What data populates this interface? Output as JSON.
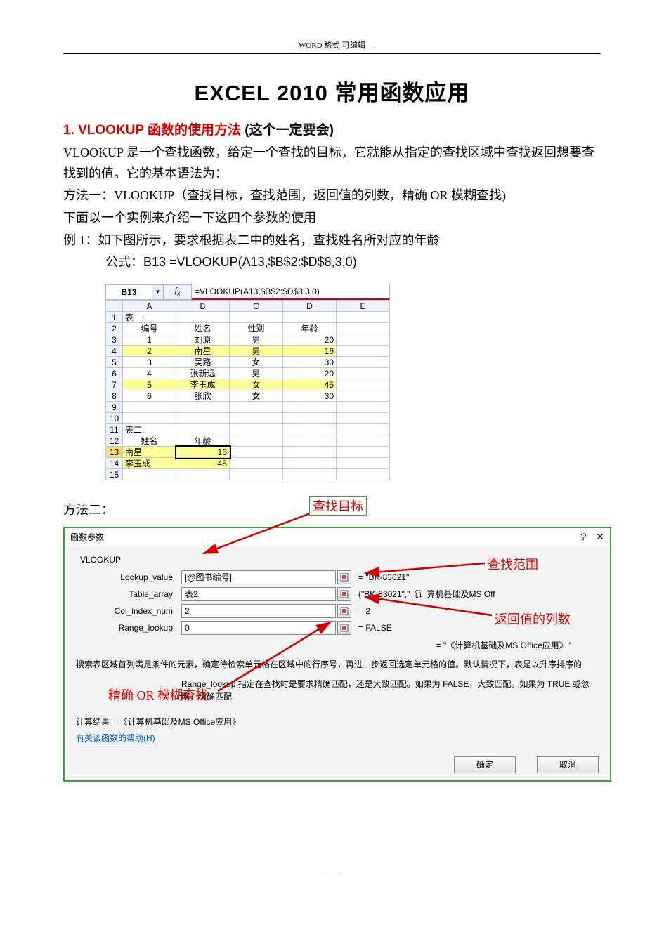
{
  "header_note": "—WORD 格式-可编辑—",
  "title": "EXCEL 2010   常用函数应用",
  "section1": {
    "num": "1. ",
    "name": "VLOOKUP   函数的使用方法 ",
    "note": "(这个一定要会)"
  },
  "para1": "VLOOKUP  是一个查找函数，给定一个查找的目标，它就能从指定的查找区域中查找返回想要查找到的值。它的基本语法为：",
  "para2": "方法一：VLOOKUP（查找目标，查找范围，返回值的列数，精确 OR  模糊查找)",
  "para3": "下面以一个实例来介绍一下这四个参数的使用",
  "para4": "例 1：如下图所示，要求根据表二中的姓名，查找姓名所对应的年龄",
  "para5": "公式：B13  =VLOOKUP(A13,$B$2:$D$8,3,0)",
  "excel": {
    "namebox": "B13",
    "formula": "=VLOOKUP(A13,$B$2:$D$8,3,0)",
    "cols": [
      "A",
      "B",
      "C",
      "D",
      "E"
    ],
    "row1": "表一:",
    "hdr": [
      "编号",
      "姓名",
      "性别",
      "年龄"
    ],
    "rows": [
      [
        "1",
        "刘原",
        "男",
        "20"
      ],
      [
        "2",
        "南星",
        "男",
        "16"
      ],
      [
        "3",
        "吴路",
        "女",
        "30"
      ],
      [
        "4",
        "张新远",
        "男",
        "20"
      ],
      [
        "5",
        "李玉成",
        "女",
        "45"
      ],
      [
        "6",
        "张欣",
        "女",
        "30"
      ]
    ],
    "row11": "表二:",
    "hdr2": [
      "姓名",
      "年龄"
    ],
    "row13": [
      "南星",
      "16"
    ],
    "row14": [
      "李玉成",
      "45"
    ]
  },
  "method2_label": "方法二：",
  "annotations": {
    "lookup_target": "查找目标",
    "lookup_range": "查找范围",
    "col_index": "返回值的列数",
    "match_type": "精确 OR  模糊查找"
  },
  "dialog": {
    "title": "函数参数",
    "fn": "VLOOKUP",
    "params": [
      {
        "label": "Lookup_value",
        "value": "[@图书编号]",
        "result": "= \"BK-83021\""
      },
      {
        "label": "Table_array",
        "value": "表2",
        "result": "{\"BK-83021\",\"《计算机基础及MS Off"
      },
      {
        "label": "Col_index_num",
        "value": "2",
        "result": "= 2"
      },
      {
        "label": "Range_lookup",
        "value": "0",
        "result": "= FALSE"
      }
    ],
    "eval_line": "= \"《计算机基础及MS Office应用》\"",
    "desc": "搜索表区域首列满足条件的元素，确定待检索单元格在区域中的行序号，再进一步返回选定单元格的值。默认情况下，表是以升序排序的",
    "range_desc": "Range_lookup   指定在查找时是要求精确匹配，还是大致匹配。如果为 FALSE，大致匹配。如果为 TRUE 或忽略，精确匹配",
    "result_label": "计算结果 =   《计算机基础及MS Office应用》",
    "help": "有关该函数的帮助(H)",
    "ok": "确定",
    "cancel": "取消"
  },
  "footer": "—"
}
